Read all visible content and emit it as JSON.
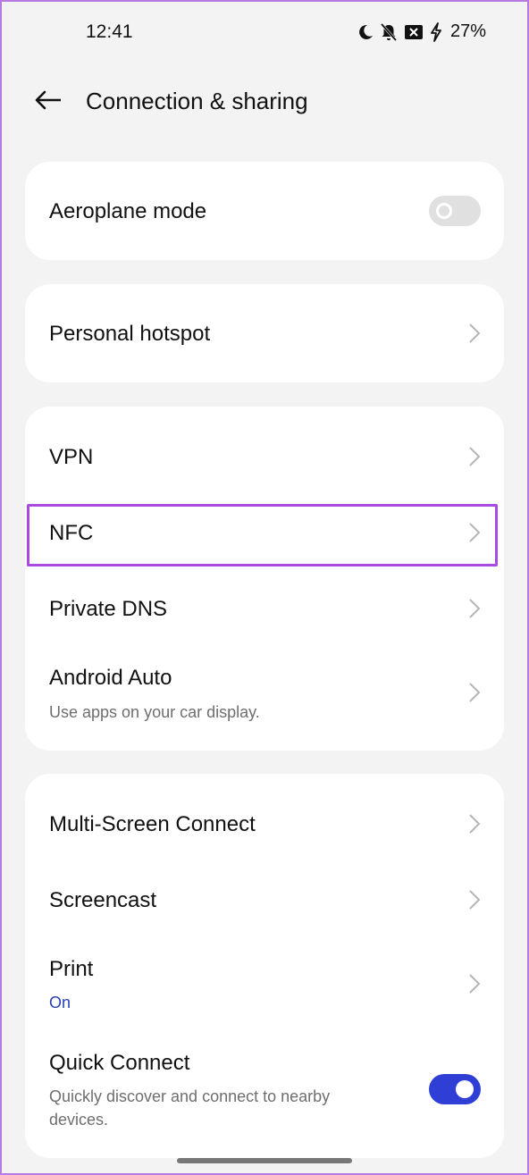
{
  "status_bar": {
    "time": "12:41",
    "battery": "27%",
    "icons": [
      "moon-icon",
      "bell-off-icon",
      "sim-x-icon",
      "charging-bolt-icon"
    ]
  },
  "header": {
    "title": "Connection & sharing",
    "back_icon": "arrow-left-icon"
  },
  "cards": {
    "aeroplane": {
      "title": "Aeroplane mode",
      "toggle": "off"
    },
    "hotspot": {
      "title": "Personal hotspot"
    },
    "network": {
      "vpn": {
        "title": "VPN"
      },
      "nfc": {
        "title": "NFC"
      },
      "private_dns": {
        "title": "Private DNS"
      },
      "android_auto": {
        "title": "Android Auto",
        "subtitle": "Use apps on your car display."
      }
    },
    "sharing": {
      "multi_screen": {
        "title": "Multi-Screen Connect"
      },
      "screencast": {
        "title": "Screencast"
      },
      "print": {
        "title": "Print",
        "subtitle": "On"
      },
      "quick_connect": {
        "title": "Quick Connect",
        "subtitle_line1": "Quickly discover and connect to nearby",
        "subtitle_line2": "devices.",
        "toggle": "on"
      }
    }
  },
  "colors": {
    "background": "#f3f3f3",
    "card": "#ffffff",
    "accent": "#2f3fd6",
    "highlight": "#a94be0",
    "link_blue": "#2a3fb0"
  }
}
